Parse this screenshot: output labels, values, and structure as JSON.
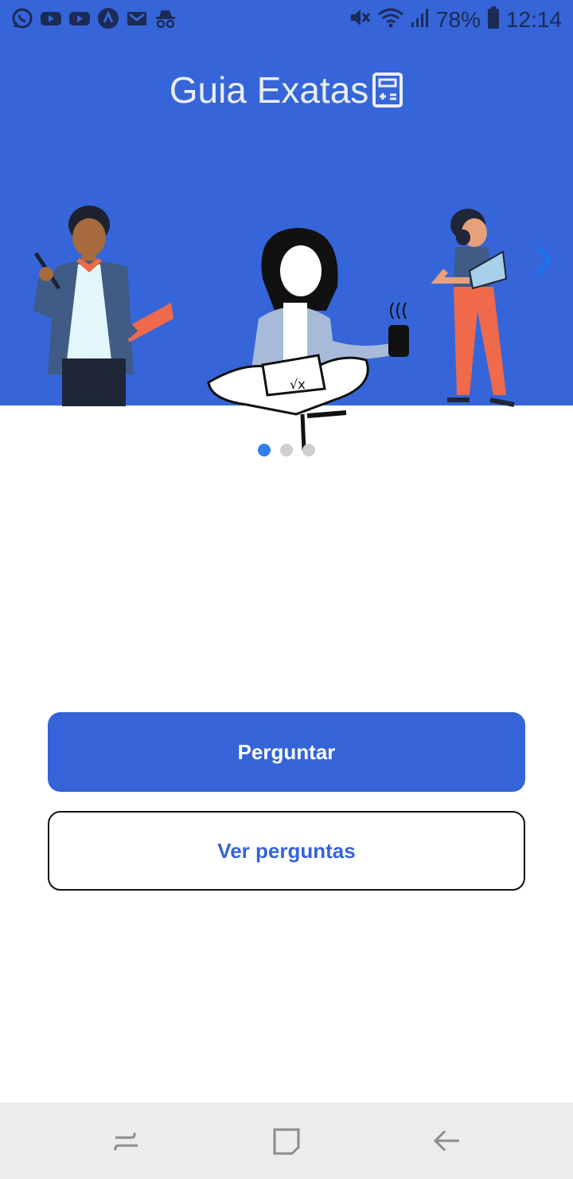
{
  "status_bar": {
    "left_icons": [
      "whatsapp-icon",
      "youtube-icon",
      "youtube-icon",
      "arc-icon",
      "gmail-icon",
      "incognito-icon"
    ],
    "battery_percent": "78%",
    "time": "12:14"
  },
  "app": {
    "title": "Guia Exatas",
    "brand_color": "#3565d8"
  },
  "carousel": {
    "total": 3,
    "active_index": 0
  },
  "actions": {
    "primary_label": "Perguntar",
    "secondary_label": "Ver perguntas"
  },
  "nav_bar": {
    "items": [
      "recents-icon",
      "home-icon",
      "back-icon"
    ]
  }
}
